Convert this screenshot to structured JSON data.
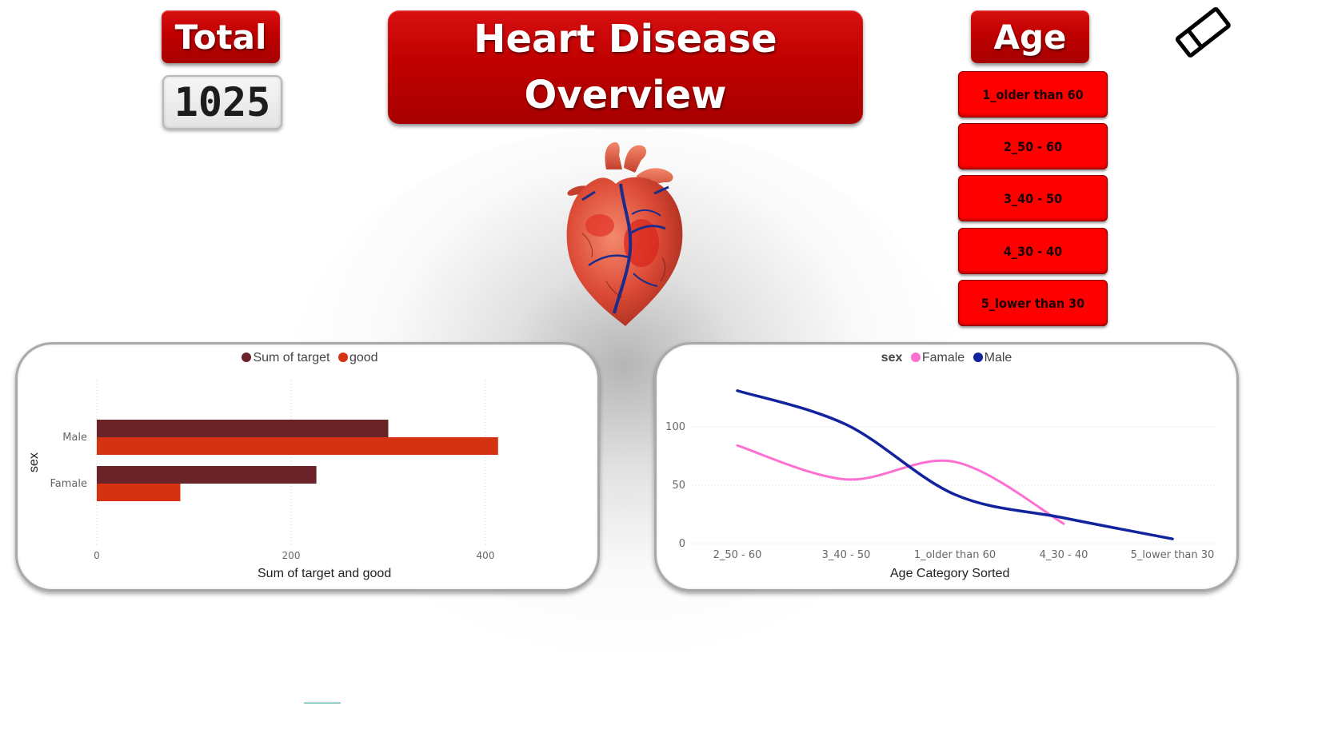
{
  "total": {
    "label": "Total",
    "value": "1025"
  },
  "title": {
    "line1": "Heart Disease",
    "line2": "Overview"
  },
  "age_slicer": {
    "label": "Age",
    "options": [
      "1_older than 60",
      "2_50 - 60",
      "3_40 - 50",
      "4_30 - 40",
      "5_lower than 30"
    ]
  },
  "colors": {
    "header_red": "#c00000",
    "slicer_red": "#ff0000",
    "target": "#6b232a",
    "good": "#d43211",
    "female": "#ff6fd1",
    "male": "#12239e"
  },
  "chart_data": [
    {
      "type": "bar",
      "orientation": "horizontal",
      "categories": [
        "Male",
        "Famale"
      ],
      "series": [
        {
          "name": "Sum of target",
          "values": [
            300,
            226
          ]
        },
        {
          "name": "good",
          "values": [
            413,
            86
          ]
        }
      ],
      "xlabel": "Sum of target and good",
      "ylabel": "sex",
      "xlim": [
        0,
        430
      ],
      "xticks": [
        0,
        200,
        400
      ],
      "legend": "top-center",
      "grid": "vertical dotted"
    },
    {
      "type": "line",
      "categories": [
        "2_50 - 60",
        "3_40 - 50",
        "1_older than 60",
        "4_30 - 40",
        "5_lower than 30"
      ],
      "legend_title": "sex",
      "series": [
        {
          "name": "Famale",
          "values": [
            84,
            55,
            70,
            17,
            null
          ]
        },
        {
          "name": "Male",
          "values": [
            131,
            102,
            42,
            22,
            4
          ]
        }
      ],
      "xlabel": "Age Category Sorted",
      "ylim": [
        0,
        140
      ],
      "yticks": [
        0,
        50,
        100
      ],
      "legend": "top-center",
      "grid": "horizontal dotted"
    }
  ]
}
